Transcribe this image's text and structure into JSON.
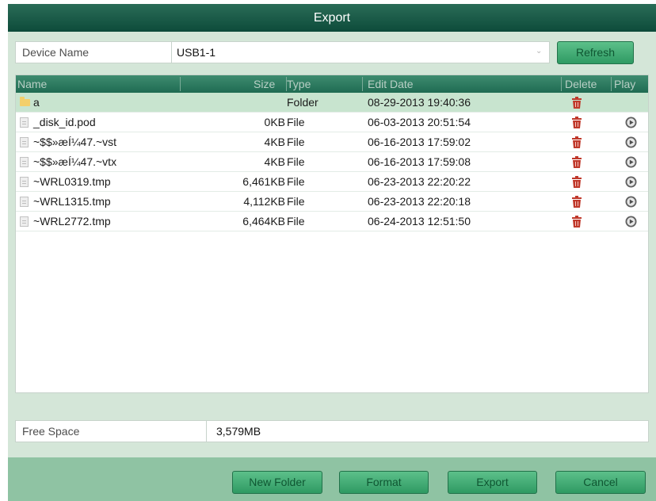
{
  "dialog": {
    "title": "Export"
  },
  "device": {
    "label": "Device Name",
    "value": "USB1-1",
    "refresh_label": "Refresh"
  },
  "table": {
    "headers": {
      "name": "Name",
      "size": "Size",
      "type": "Type",
      "date": "Edit Date",
      "delete": "Delete",
      "play": "Play"
    },
    "rows": [
      {
        "icon": "folder-icon",
        "name": "a",
        "size": "",
        "type": "Folder",
        "date": "08-29-2013 19:40:36",
        "playable": false,
        "selected": true
      },
      {
        "icon": "file-icon",
        "name": "_disk_id.pod",
        "size": "0KB",
        "type": "File",
        "date": "06-03-2013 20:51:54",
        "playable": true
      },
      {
        "icon": "file-icon",
        "name": "~$$»æÍ¼47.~vst",
        "size": "4KB",
        "type": "File",
        "date": "06-16-2013 17:59:02",
        "playable": true
      },
      {
        "icon": "file-icon",
        "name": "~$$»æÍ¼47.~vtx",
        "size": "4KB",
        "type": "File",
        "date": "06-16-2013 17:59:08",
        "playable": true
      },
      {
        "icon": "file-icon",
        "name": "~WRL0319.tmp",
        "size": "6,461KB",
        "type": "File",
        "date": "06-23-2013 22:20:22",
        "playable": true
      },
      {
        "icon": "file-icon",
        "name": "~WRL1315.tmp",
        "size": "4,112KB",
        "type": "File",
        "date": "06-23-2013 22:20:18",
        "playable": true
      },
      {
        "icon": "file-icon",
        "name": "~WRL2772.tmp",
        "size": "6,464KB",
        "type": "File",
        "date": "06-24-2013 12:51:50",
        "playable": true
      }
    ]
  },
  "free_space": {
    "label": "Free Space",
    "value": "3,579MB"
  },
  "buttons": {
    "new_folder": "New Folder",
    "format": "Format",
    "export": "Export",
    "cancel": "Cancel"
  },
  "colors": {
    "accent": "#2f9a63",
    "title_bar": "#1a5c47",
    "delete_icon": "#c0392b"
  }
}
